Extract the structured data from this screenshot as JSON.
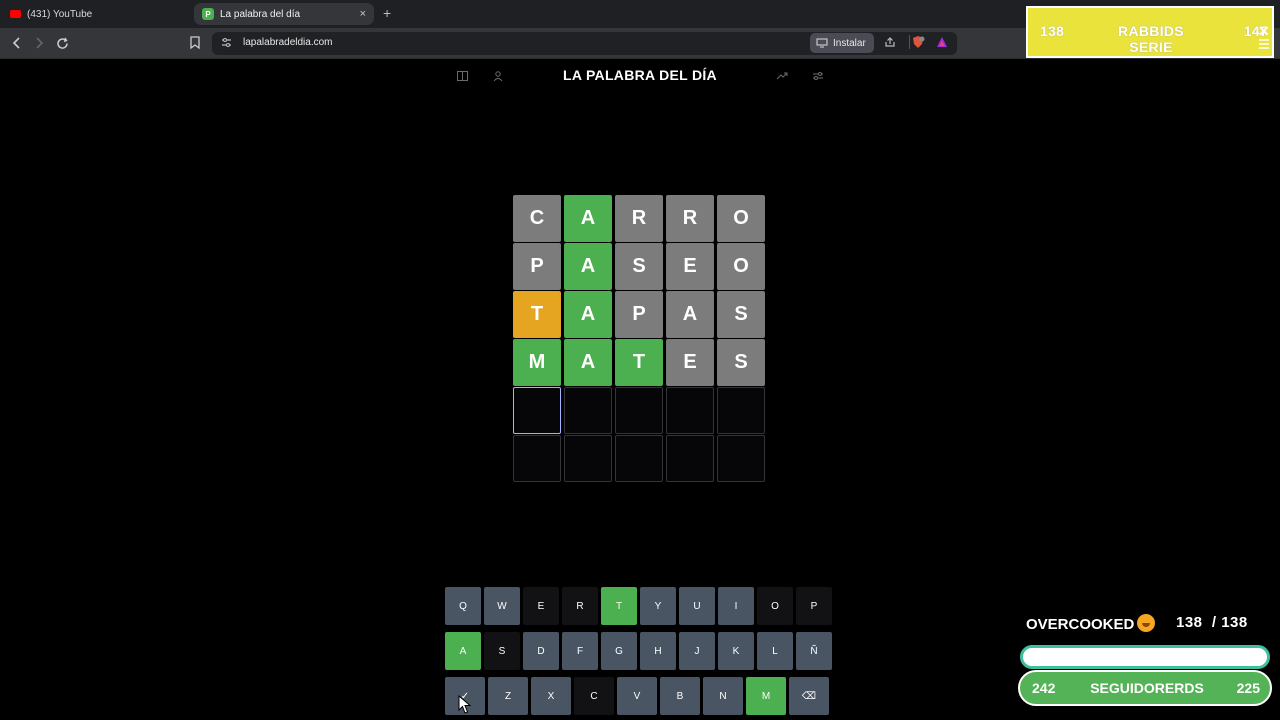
{
  "browser": {
    "tabs": [
      {
        "title": "(431) YouTube",
        "favicon": "youtube-icon"
      },
      {
        "title": "La palabra del día",
        "favicon": "palabra-icon",
        "favicon_letter": "P",
        "close": "×"
      }
    ],
    "new_tab": "+",
    "url": "lapalabradeldia.com",
    "install_label": "Instalar"
  },
  "overlay": {
    "rabbids": {
      "left": "138",
      "title": "RABBIDS SERIE",
      "right": "147"
    },
    "overcooked": {
      "label": "OVERCOOKED",
      "count": "138",
      "separator": "/",
      "total": "138"
    },
    "followers": {
      "left": "242",
      "title": "SEGUIDORERDS",
      "right": "225"
    }
  },
  "game": {
    "title": "LA PALABRA DEL DÍA",
    "board": [
      [
        {
          "l": "C",
          "s": "gray"
        },
        {
          "l": "A",
          "s": "green"
        },
        {
          "l": "R",
          "s": "gray"
        },
        {
          "l": "R",
          "s": "gray"
        },
        {
          "l": "O",
          "s": "gray"
        }
      ],
      [
        {
          "l": "P",
          "s": "gray"
        },
        {
          "l": "A",
          "s": "green"
        },
        {
          "l": "S",
          "s": "gray"
        },
        {
          "l": "E",
          "s": "gray"
        },
        {
          "l": "O",
          "s": "gray"
        }
      ],
      [
        {
          "l": "T",
          "s": "yellow"
        },
        {
          "l": "A",
          "s": "green"
        },
        {
          "l": "P",
          "s": "gray"
        },
        {
          "l": "A",
          "s": "gray"
        },
        {
          "l": "S",
          "s": "gray"
        }
      ],
      [
        {
          "l": "M",
          "s": "green"
        },
        {
          "l": "A",
          "s": "green"
        },
        {
          "l": "T",
          "s": "green"
        },
        {
          "l": "E",
          "s": "gray"
        },
        {
          "l": "S",
          "s": "gray"
        }
      ],
      [
        {
          "l": "",
          "s": "active"
        },
        {
          "l": "",
          "s": "empty"
        },
        {
          "l": "",
          "s": "empty"
        },
        {
          "l": "",
          "s": "empty"
        },
        {
          "l": "",
          "s": "empty"
        }
      ],
      [
        {
          "l": "",
          "s": "empty"
        },
        {
          "l": "",
          "s": "empty"
        },
        {
          "l": "",
          "s": "empty"
        },
        {
          "l": "",
          "s": "empty"
        },
        {
          "l": "",
          "s": "empty"
        }
      ]
    ],
    "keyboard": [
      [
        {
          "k": "Q",
          "s": "unused"
        },
        {
          "k": "W",
          "s": "unused"
        },
        {
          "k": "E",
          "s": "absent"
        },
        {
          "k": "R",
          "s": "absent"
        },
        {
          "k": "T",
          "s": "green"
        },
        {
          "k": "Y",
          "s": "unused"
        },
        {
          "k": "U",
          "s": "unused"
        },
        {
          "k": "I",
          "s": "unused"
        },
        {
          "k": "O",
          "s": "absent"
        },
        {
          "k": "P",
          "s": "absent"
        }
      ],
      [
        {
          "k": "A",
          "s": "green"
        },
        {
          "k": "S",
          "s": "absent"
        },
        {
          "k": "D",
          "s": "unused"
        },
        {
          "k": "F",
          "s": "unused"
        },
        {
          "k": "G",
          "s": "unused"
        },
        {
          "k": "H",
          "s": "unused"
        },
        {
          "k": "J",
          "s": "unused"
        },
        {
          "k": "K",
          "s": "unused"
        },
        {
          "k": "L",
          "s": "unused"
        },
        {
          "k": "Ñ",
          "s": "unused"
        }
      ],
      [
        {
          "k": "✓",
          "s": "enter"
        },
        {
          "k": "Z",
          "s": "unused"
        },
        {
          "k": "X",
          "s": "unused"
        },
        {
          "k": "C",
          "s": "absent"
        },
        {
          "k": "V",
          "s": "unused"
        },
        {
          "k": "B",
          "s": "unused"
        },
        {
          "k": "N",
          "s": "unused"
        },
        {
          "k": "M",
          "s": "green"
        },
        {
          "k": "⌫",
          "s": "back"
        }
      ]
    ]
  }
}
